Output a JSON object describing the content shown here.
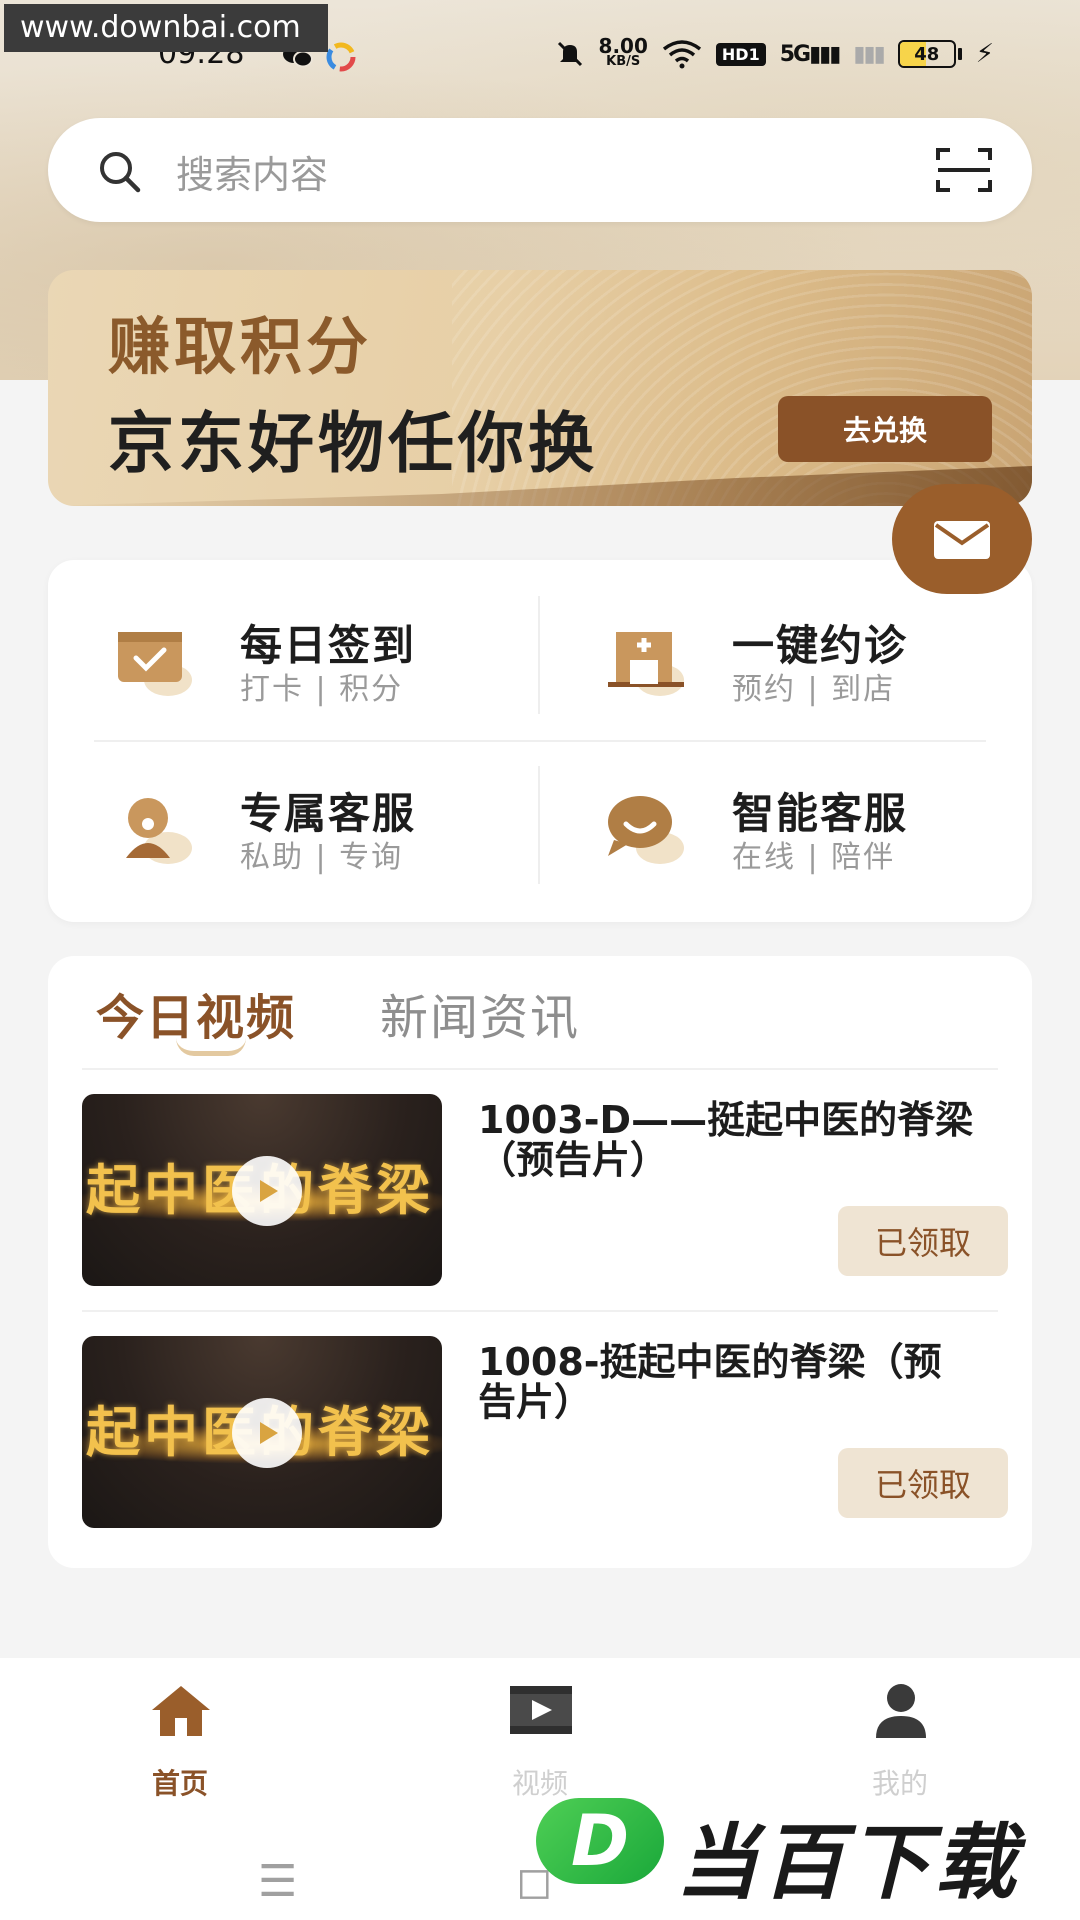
{
  "watermark": {
    "url": "www.downbai.com",
    "brand_letter": "D",
    "brand_text": "当百下载"
  },
  "status_bar": {
    "time": "09:28",
    "speed_value": "8.00",
    "speed_unit": "KB/S",
    "hd_label": "HD1",
    "network": "5G",
    "battery": "48",
    "battery_level": 0.48
  },
  "search": {
    "placeholder": "搜索内容"
  },
  "banner": {
    "line1": "赚取积分",
    "line2": "京东好物任你换",
    "button": "去兑换"
  },
  "services": [
    {
      "title": "每日签到",
      "subtitle": "打卡 | 积分",
      "icon": "checkin-icon"
    },
    {
      "title": "一键约诊",
      "subtitle": "预约 | 到店",
      "icon": "clinic-icon"
    },
    {
      "title": "专属客服",
      "subtitle": "私助 | 专询",
      "icon": "agent-icon"
    },
    {
      "title": "智能客服",
      "subtitle": "在线 | 陪伴",
      "icon": "chat-icon"
    }
  ],
  "video_section": {
    "tabs": [
      {
        "label": "今日视频",
        "active": true
      },
      {
        "label": "新闻资讯",
        "active": false
      }
    ],
    "items": [
      {
        "title": "1003-D——挺起中医的脊梁（预告片）",
        "thumb_text": "起中医的脊梁",
        "button": "已领取"
      },
      {
        "title": "1008-挺起中医的脊梁（预告片）",
        "thumb_text": "起中医的脊梁",
        "button": "已领取"
      }
    ]
  },
  "bottom_nav": {
    "items": [
      {
        "label": "首页",
        "icon": "home-icon",
        "active": true
      },
      {
        "label": "视频",
        "icon": "video-icon",
        "active": false
      },
      {
        "label": "我的",
        "icon": "user-icon",
        "active": false
      }
    ]
  },
  "colors": {
    "accent": "#8a5228",
    "claim_bg": "#efe4d3",
    "fab": "#9a5e2b"
  }
}
